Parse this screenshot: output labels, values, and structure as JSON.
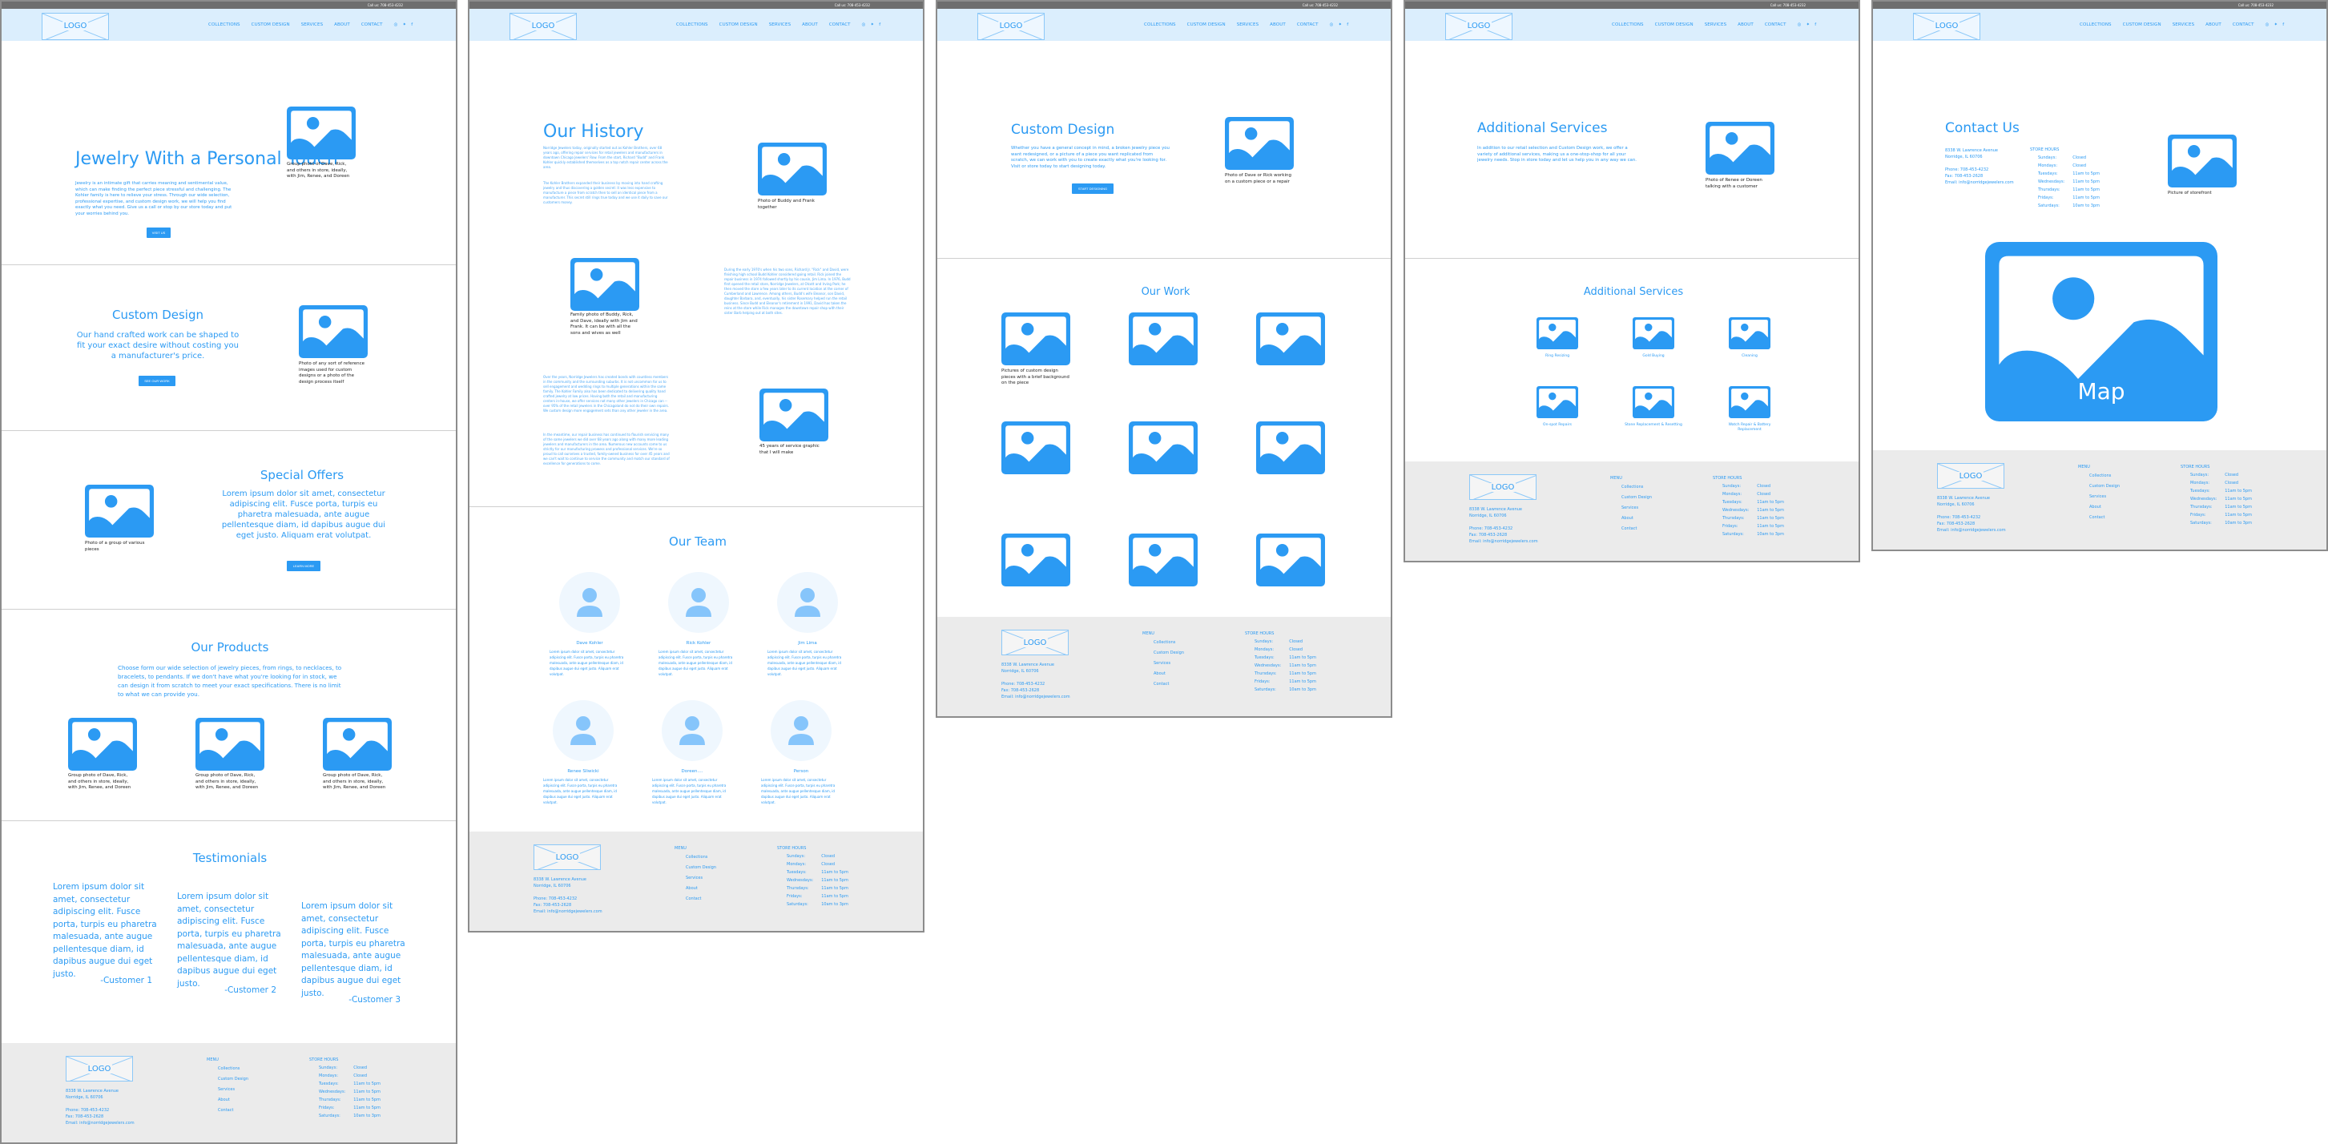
{
  "topbar": {
    "call": "Call us: 708-453-4232"
  },
  "logo": "LOGO",
  "nav": [
    "COLLECTIONS",
    "CUSTOM DESIGN",
    "SERVICES",
    "ABOUT",
    "CONTACT"
  ],
  "social": {
    "instagram": "◎",
    "twitter": "✦",
    "facebook": "f"
  },
  "colors": {
    "accent": "#2b9af3",
    "header_bg": "#dbeefd",
    "topbar": "#6e6e6e",
    "footer_bg": "#ebebeb",
    "avatar_bg": "#eff7fe",
    "avatar_fg": "#86c5fb"
  },
  "footer": {
    "address1": "8338 W. Lawrence Avenue",
    "address2": "Norridge, IL 60706",
    "phone": "Phone: 708-453-4232",
    "fax": "Fax: 708-453-2628",
    "email": "Email: info@norridgejewelers.com",
    "menu_heading": "MENU",
    "menu": [
      "Collections",
      "Custom Design",
      "Services",
      "About",
      "Contact"
    ],
    "hours_heading": "STORE HOURS",
    "hours": [
      {
        "day": "Sundays:",
        "time": "Closed"
      },
      {
        "day": "Mondays:",
        "time": "Closed"
      },
      {
        "day": "Tuesdays:",
        "time": "11am to 5pm"
      },
      {
        "day": "Wednesdays:",
        "time": "11am to 5pm"
      },
      {
        "day": "Thursdays:",
        "time": "11am to 5pm"
      },
      {
        "day": "Fridays:",
        "time": "11am to 5pm"
      },
      {
        "day": "Saturdays:",
        "time": "10am to 3pm"
      }
    ]
  },
  "home": {
    "hero": {
      "title": "Jewelry With a Personal Touch",
      "body": "Jewelry is an intimate gift that carries meaning and sentimental value, which can make finding the perfect piece stressful and challenging. The Kohler family is here to relieve your stress. Through our wide selection, professional expertise, and custom design work, we will help you find exactly what you need. Give us a call or stop by our store today and put your worries behind you.",
      "button": "VISIT US",
      "caption": "Group photo of Dave, Rick, and others in store, ideally, with Jim, Renee, and Doreen"
    },
    "custom": {
      "title": "Custom Design",
      "body": "Our hand crafted work can be shaped to fit your exact desire without costing you a manufacturer's price.",
      "button": "SEE OUR WORK",
      "caption": "Photo of any sort of reference images used for custom designs or a photo of the design process itself"
    },
    "offers": {
      "title": "Special Offers",
      "body": "Lorem ipsum dolor sit amet, consectetur adipiscing elit. Fusce porta, turpis eu pharetra malesuada, ante augue pellentesque diam, id dapibus augue dui eget justo. Aliquam erat volutpat.",
      "button": "LEARN MORE",
      "caption": "Photo of a group of various pieces"
    },
    "products": {
      "title": "Our Products",
      "body": "Choose form our wide selection of jewelry pieces, from rings, to necklaces, to bracelets, to pendants. If we don't have what you're looking for in stock, we can design it from scratch to meet your exact specifications. There is no limit to what we can provide you.",
      "captions": [
        "Group photo of Dave, Rick, and others in store, ideally, with Jim, Renee, and Doreen",
        "Group photo of Dave, Rick, and others in store, ideally, with Jim, Renee, and Doreen",
        "Group photo of Dave, Rick, and others in store, ideally, with Jim, Renee, and Doreen"
      ]
    },
    "testimonials": {
      "title": "Testimonials",
      "items": [
        {
          "text": "Lorem ipsum dolor sit amet, consectetur adipiscing elit. Fusce porta, turpis eu pharetra malesuada, ante augue pellentesque diam, id dapibus augue dui eget justo.",
          "author": "-Customer 1"
        },
        {
          "text": "Lorem ipsum dolor sit amet, consectetur adipiscing elit. Fusce porta, turpis eu pharetra malesuada, ante augue pellentesque diam, id dapibus augue dui eget justo.",
          "author": "-Customer 2"
        },
        {
          "text": "Lorem ipsum dolor sit amet, consectetur adipiscing elit. Fusce porta, turpis eu pharetra malesuada, ante augue pellentesque diam, id dapibus augue dui eget justo.",
          "author": "-Customer 3"
        }
      ]
    }
  },
  "about": {
    "title": "Our History",
    "p1": "Norridge Jewelers today, originally started out as Kohler Brothers, over 68 years ago, offering repair services for retail jewelers and manufacturers in downtown Chicago Jewelers' Row. From the start, Richard \"Budd\" and Frank Kohler quickly established themselves as a top notch repair center across the area.",
    "p2": "The Kohler Brothers expanded their business by moving into hand crafting jewelry and thus discovering a golden secret: it was less expensive to manufacture a piece from scratch then to sell an identical piece from a manufacturer. This secret still rings true today and we use it daily to save our customers money.",
    "cap1": "Photo of Buddy and Frank together",
    "cap2": "Family photo of Buddy, Rick, and Dave, ideally with Jim and Frank. It can be with all the sons and wives as well",
    "p3": "During the early 1970's when his two sons, Richard Jr. \"Rick\" and David, were finishing high school Budd Kohler considered going retail. Rick joined the repair business in 1974 followed shortly by his cousin, Jim Lima. In 1976, Budd first opened the retail store, Norridge Jewelers, at Olcott and Irving Park; he then moved the store a few years later to its current location at the corner of Cumberland and Lawrence. Among others, Budd's wife Eleanor, son David, daughter Barbara, and, eventually, his sister Rosemary helped run the retail business. Since Budd and Eleanor's retirement in 1991, David has taken the reins at the store while Rick manages the downtown repair shop with their sister Barb helping out at both sites.",
    "p4": "Over the years, Norridge Jewelers has created bonds with countless members in the community and the surrounding suburbs. It is not uncommon for us to sell engagement and wedding rings to multiple generations within the same family. The Kohler Family also has been dedicated to delivering quality hand crafted jewelry at low prices. Having both the retail and manufacturing centers in-house, we offer services not many other jewelers in Chicago can -- over 95% of the retail jewelers in the Chicagoland do not do their own repairs. We custom design more engagement sets than any other jeweler in the area.",
    "p5": "In the meantime, our repair business has continued to flourish servicing many of the same jewelers we did over 68 years ago along with many more leading jewelers and manufacturers in the area. Numerous new accounts come to us strictly for our manufacturing prowess and professional services. We're so proud to call ourselves a trusted, family-owned business for over 45 years and we can't wait to continue to service the community and match our standard of excellence for generations to come.",
    "cap3": "45 years of service graphic that I will make",
    "team_title": "Our Team",
    "team": [
      {
        "name": "Dave Kohler",
        "bio": "Lorem ipsum dolor sit amet, consectetur adipiscing elit. Fusce porta, turpis eu pharetra malesuada, ante augue pellentesque diam, id dapibus augue dui eget justo. Aliquam erat volutpat."
      },
      {
        "name": "Rick Kohler",
        "bio": "Lorem ipsum dolor sit amet, consectetur adipiscing elit. Fusce porta, turpis eu pharetra malesuada, ante augue pellentesque diam, id dapibus augue dui eget justo. Aliquam erat volutpat."
      },
      {
        "name": "Jim Lima",
        "bio": "Lorem ipsum dolor sit amet, consectetur adipiscing elit. Fusce porta, turpis eu pharetra malesuada, ante augue pellentesque diam, id dapibus augue dui eget justo. Aliquam erat volutpat."
      },
      {
        "name": "Renee Sliwicki",
        "bio": "Lorem ipsum dolor sit amet, consectetur adipiscing elit. Fusce porta, turpis eu pharetra malesuada, ante augue pellentesque diam, id dapibus augue dui eget justo. Aliquam erat volutpat."
      },
      {
        "name": "Doreen....",
        "bio": "Lorem ipsum dolor sit amet, consectetur adipiscing elit. Fusce porta, turpis eu pharetra malesuada, ante augue pellentesque diam, id dapibus augue dui eget justo. Aliquam erat volutpat."
      },
      {
        "name": "Person",
        "bio": "Lorem ipsum dolor sit amet, consectetur adipiscing elit. Fusce porta, turpis eu pharetra malesuada, ante augue pellentesque diam, id dapibus augue dui eget justo. Aliquam erat volutpat."
      }
    ]
  },
  "custom_page": {
    "title": "Custom Design",
    "body": "Whether you have a general concept in mind, a broken jewelry piece you want redesigned, or a picture of a piece you want replicated from scratch, we can work with you to create exactly what you're looking for. Visit or store today to start designing today.",
    "button": "START DESIGNING",
    "caption": "Photo of Dave or Rick working on a custom piece or a repair",
    "work_title": "Our Work",
    "work_caption": "Pictures of custom design pieces with a brief background on the piece"
  },
  "services_page": {
    "title": "Additional Services",
    "body": "In addition to our retail selection and Custom Design work, we offer a variety of additional services, making us a one-stop-shop for all your jewelry needs. Stop in store today and let us help you in any way we can.",
    "caption": "Photo of Renee or Doreen talking with a customer",
    "grid_title": "Additional Services",
    "items": [
      "Ring Resizing",
      "Gold Buying",
      "Cleaning",
      "On-spot Repairs",
      "Stone Replacement & Resetting",
      "Watch Repair & Battery Replacement"
    ]
  },
  "contact_page": {
    "title": "Contact Us",
    "caption": "Picture of storefront",
    "map_label": "Map"
  }
}
